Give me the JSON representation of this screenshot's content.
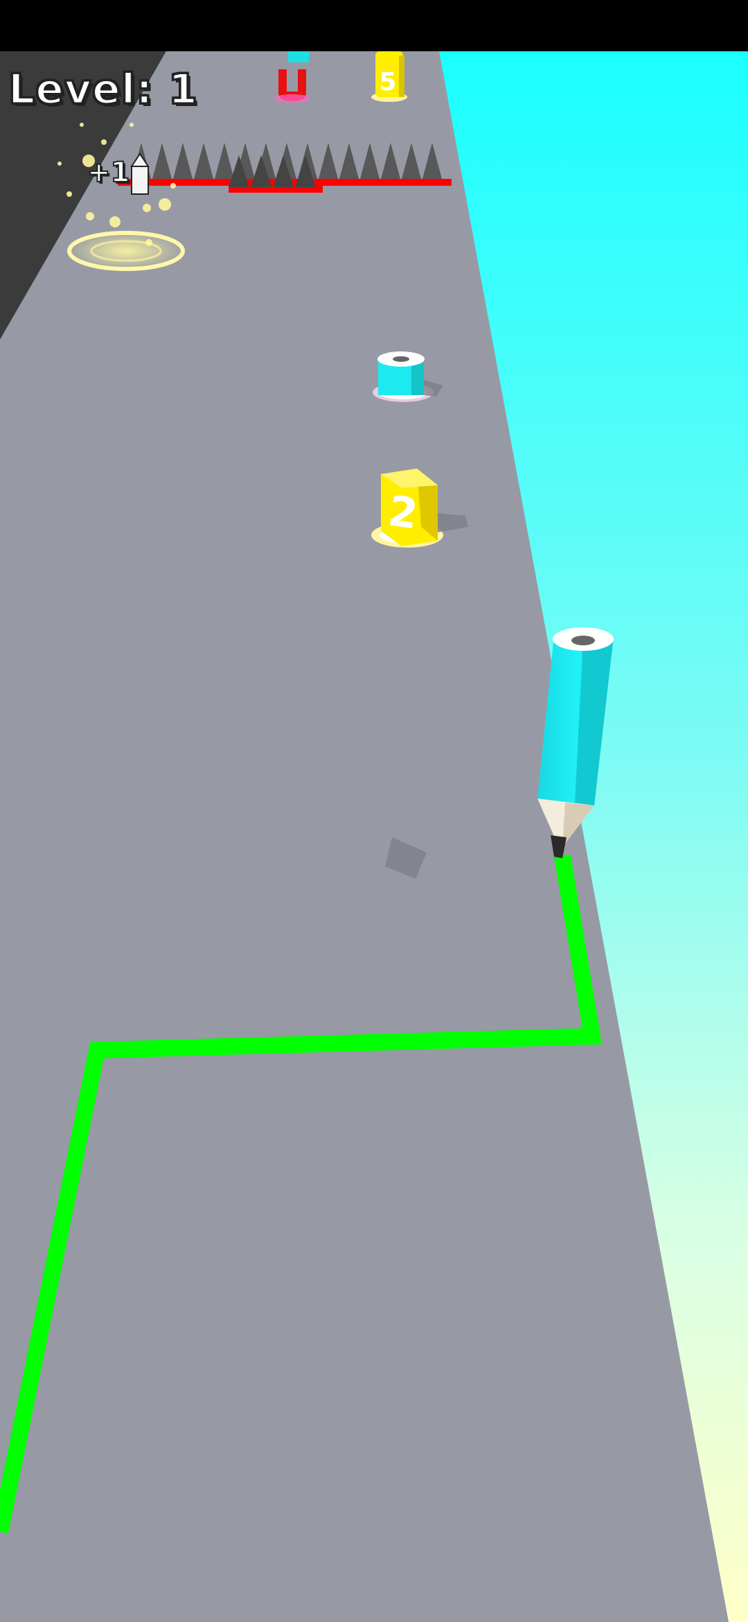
{
  "hud": {
    "level_label": "Level: 1",
    "bonus_label": "+1"
  },
  "pickups": {
    "number_block_near": "2",
    "number_block_far": "5",
    "magnet_letter": "U"
  },
  "colors": {
    "track": "#979aa5",
    "track_edge_wall": "#3b3b3b",
    "sky_top": "#1affff",
    "sky_bottom": "#ffffc8",
    "drawn_line": "#00ff00",
    "pencil_body": "#1de9f0",
    "number_block": "#ffee00",
    "spike": "#555555",
    "spike_base": "#ff0000"
  },
  "icons": {
    "player": "pencil-icon",
    "pencil_pickup": "pencil-stub-icon",
    "magnet_pickup": "magnet-icon",
    "obstacle": "spike-icon",
    "portal": "glow-ring-icon"
  }
}
